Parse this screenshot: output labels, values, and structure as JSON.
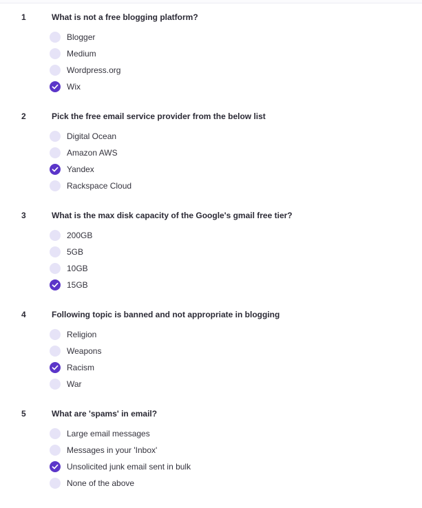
{
  "questions": [
    {
      "number": "1",
      "text": "What is not a free blogging platform?",
      "options": [
        {
          "label": "Blogger",
          "selected": false
        },
        {
          "label": "Medium",
          "selected": false
        },
        {
          "label": "Wordpress.org",
          "selected": false
        },
        {
          "label": "Wix",
          "selected": true
        }
      ]
    },
    {
      "number": "2",
      "text": "Pick the free email service provider from the below list",
      "options": [
        {
          "label": "Digital Ocean",
          "selected": false
        },
        {
          "label": "Amazon AWS",
          "selected": false
        },
        {
          "label": "Yandex",
          "selected": true
        },
        {
          "label": "Rackspace Cloud",
          "selected": false
        }
      ]
    },
    {
      "number": "3",
      "text": "What is the max disk capacity of the Google's gmail free tier?",
      "options": [
        {
          "label": "200GB",
          "selected": false
        },
        {
          "label": "5GB",
          "selected": false
        },
        {
          "label": "10GB",
          "selected": false
        },
        {
          "label": "15GB",
          "selected": true
        }
      ]
    },
    {
      "number": "4",
      "text": "Following topic is banned and not appropriate in blogging",
      "options": [
        {
          "label": "Religion",
          "selected": false
        },
        {
          "label": "Weapons",
          "selected": false
        },
        {
          "label": "Racism",
          "selected": true
        },
        {
          "label": "War",
          "selected": false
        }
      ]
    },
    {
      "number": "5",
      "text": "What are 'spams' in email?",
      "options": [
        {
          "label": "Large email messages",
          "selected": false
        },
        {
          "label": "Messages in your 'Inbox'",
          "selected": false
        },
        {
          "label": "Unsolicited junk email sent in bulk",
          "selected": true
        },
        {
          "label": "None of the above",
          "selected": false
        }
      ]
    }
  ],
  "colors": {
    "radio_checked": "#5b35c9",
    "radio_unchecked": "#e6e3f7",
    "text": "#2b2a35"
  },
  "icons": {
    "checked": "checkmark-icon"
  }
}
